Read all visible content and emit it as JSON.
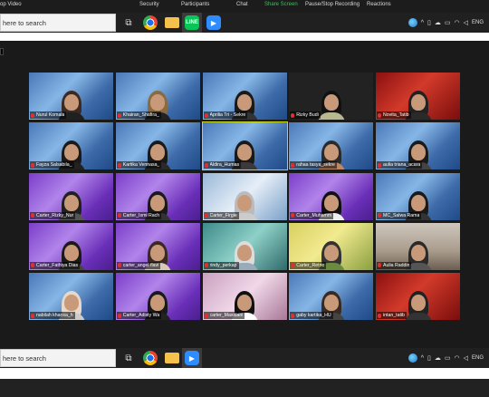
{
  "zoom_toolbar": {
    "stop_video": "op Video",
    "security": "Security",
    "participants": "Participants",
    "chat": "Chat",
    "share_screen": "Share Screen",
    "record": "Pause/Stop Recording",
    "reactions": "Reactions"
  },
  "taskbar": {
    "search_placeholder": "here to search",
    "apps": [
      "task-view",
      "chrome",
      "file-explorer",
      "line",
      "zoom"
    ],
    "tray": {
      "language": "ENG"
    }
  },
  "participants": [
    {
      "name": "Nurul Komala",
      "bg": "blue",
      "hair": "#3a2a22",
      "shirt": "#202020"
    },
    {
      "name": "Khairan_Shafira_",
      "bg": "blue",
      "hair": "#8a6a40",
      "shirt": "#222"
    },
    {
      "name": "Aprilia Tri - Sekre",
      "bg": "blue",
      "hair": "#1a1a1a",
      "shirt": "#333"
    },
    {
      "name": "Rizky Budi",
      "bg": "dark",
      "hair": "#111",
      "shirt": "#b8b890"
    },
    {
      "name": "Novita_Tatib",
      "bg": "red",
      "hair": "#222",
      "shirt": "#2a2a2a"
    },
    {
      "name": "Fayza Salsabila_",
      "bg": "blue",
      "hair": "#1a1a1a",
      "shirt": "#222"
    },
    {
      "name": "Kartika Vennasa_",
      "bg": "blue",
      "hair": "#1a1a1a",
      "shirt": "#2a2a2a"
    },
    {
      "name": "Aldira_Humas",
      "bg": "blue",
      "hair": "#1a1a1a",
      "shirt": "#3a3a3a",
      "active": true
    },
    {
      "name": "rahaa tasya_sekre",
      "bg": "blue",
      "hair": "#2a2a2a",
      "shirt": "#bb8866"
    },
    {
      "name": "aulia triana_acara",
      "bg": "blue",
      "hair": "#1a1a1a",
      "shirt": "#444"
    },
    {
      "name": "Carter_Rizky_Nur",
      "bg": "purple",
      "hair": "#202020",
      "shirt": "#555"
    },
    {
      "name": "Carter_Ismi Rach",
      "bg": "purple",
      "hair": "#1a1a1a",
      "shirt": "#333"
    },
    {
      "name": "Carter_Firgie",
      "bg": "light",
      "hair": "#bbb",
      "shirt": "#ccc"
    },
    {
      "name": "Carter_Muhamm",
      "bg": "purple",
      "hair": "#111",
      "shirt": "#eee"
    },
    {
      "name": "MC_Salwa Rama",
      "bg": "blue",
      "hair": "#1a1a1a",
      "shirt": "#333"
    },
    {
      "name": "Carter_Fathiya Dias",
      "bg": "purple",
      "hair": "#1a1a1a",
      "shirt": "#444"
    },
    {
      "name": "carter_angel flavi",
      "bg": "purple",
      "hair": "#3a2a22",
      "shirt": "#d8c8b8"
    },
    {
      "name": "rindy_perkap",
      "bg": "teal",
      "hair": "#ddd",
      "shirt": "#9ab"
    },
    {
      "name": "Carter_Retno",
      "bg": "yellow",
      "hair": "#333",
      "shirt": "#6a8a40"
    },
    {
      "name": "Aulia Raddin",
      "bg": "room",
      "hair": "#2a2a2a",
      "shirt": "#555"
    },
    {
      "name": "nabilah khansa_h",
      "bg": "blue",
      "hair": "#e8d8c8",
      "shirt": "#ccc"
    },
    {
      "name": "Carter_Adisty Wa",
      "bg": "purple",
      "hair": "#1a1a1a",
      "shirt": "#222"
    },
    {
      "name": "carter_Maxidani",
      "bg": "pink",
      "hair": "#111",
      "shirt": "#fff"
    },
    {
      "name": "gaby kartika_HU",
      "bg": "blue",
      "hair": "#3a2a22",
      "shirt": "#444"
    },
    {
      "name": "intan_tatib",
      "bg": "red",
      "hair": "#222",
      "shirt": "#333"
    }
  ]
}
